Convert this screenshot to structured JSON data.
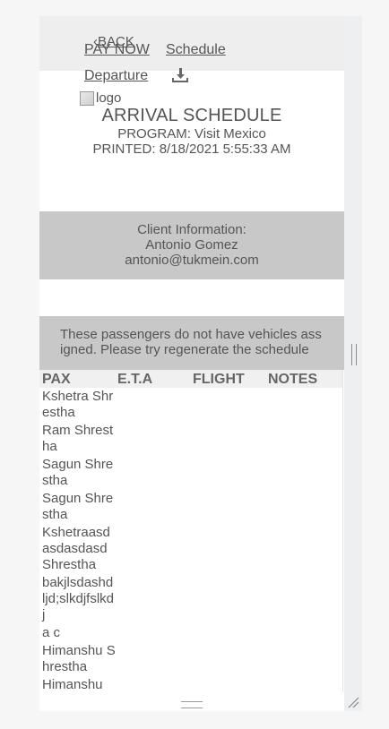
{
  "nav": {
    "back_label": "BACK",
    "pay_now_label": "PAY NOW",
    "schedule_label": "Schedule",
    "departure_label": "Departure"
  },
  "logo_alt": "logo",
  "header": {
    "title": "ARRIVAL SCHEDULE",
    "program": "PROGRAM: Visit Mexico",
    "printed": "PRINTED: 8/18/2021 5:55:33 AM"
  },
  "client": {
    "heading": "Client Information:",
    "name": "Antonio Gomez",
    "email": "antonio@tukmein.com"
  },
  "warning": "These passengers do not have vehicles assigned. Please try regenerate the schedule",
  "table": {
    "columns": [
      "PAX",
      "E.T.A",
      "FLIGHT",
      "NOTES"
    ],
    "pax": [
      "Kshetra Shrestha",
      "Ram Shrestha",
      "Sagun Shrestha",
      "Sagun Shrestha",
      "Kshetraasdasdasdasd Shrestha",
      "bakjlsdashd ljd;slkdjfslkdj",
      "a c",
      "Himanshu Shrestha",
      "Himanshu"
    ]
  }
}
